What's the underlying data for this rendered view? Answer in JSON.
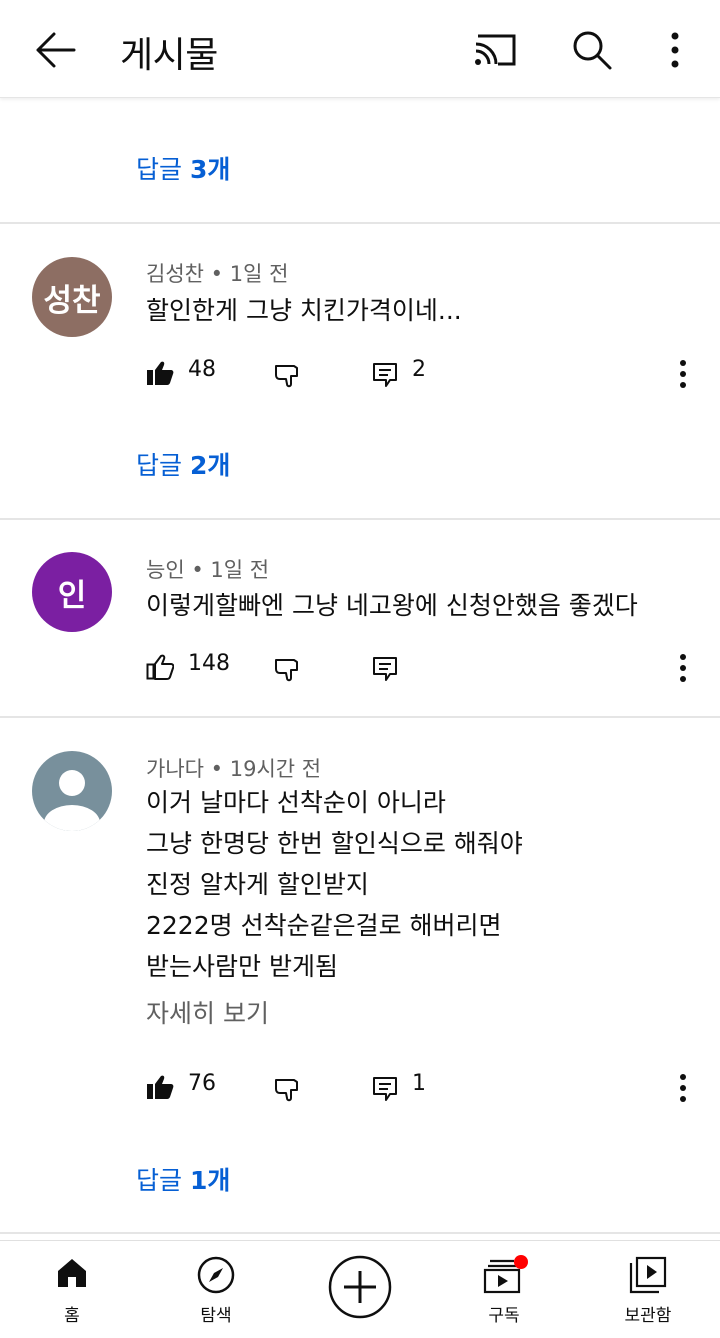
{
  "header": {
    "title": "게시물",
    "icons": [
      "back-arrow-icon",
      "cast-icon",
      "search-icon",
      "more-vert-icon"
    ]
  },
  "top_replies": {
    "prefix": "답글",
    "count_label": "3개"
  },
  "comments": [
    {
      "avatar_text": "성찬",
      "avatar_color": "#8d6e63",
      "author": "김성찬",
      "time": "1일 전",
      "lines": [
        "할인한게 그냥 치킨가격이네..."
      ],
      "likes": "48",
      "liked": true,
      "reply_count": "2",
      "replies": {
        "prefix": "답글",
        "count_label": "2개"
      }
    },
    {
      "avatar_text": "인",
      "avatar_color": "#7b1fa2",
      "author": "능인",
      "time": "1일 전",
      "lines": [
        "이렇게할빠엔 그냥 네고왕에 신청안했음 좋겠다"
      ],
      "likes": "148",
      "liked": false,
      "reply_count": ""
    },
    {
      "avatar_text": "",
      "avatar_color": "#78909c",
      "author": "가나다",
      "time": "19시간 전",
      "lines": [
        "이거 날마다 선착순이 아니라",
        "그냥 한명당 한번 할인식으로 해줘야",
        "진정 알차게 할인받지",
        "2222명 선착순같은걸로 해버리면",
        "받는사람만 받게됨"
      ],
      "read_more": "자세히 보기",
      "likes": "76",
      "liked": true,
      "reply_count": "1",
      "replies": {
        "prefix": "답글",
        "count_label": "1개"
      }
    }
  ],
  "bottom_nav": [
    {
      "label": "홈",
      "icon": "home-icon"
    },
    {
      "label": "탐색",
      "icon": "explore-icon"
    },
    {
      "label": "",
      "icon": "create-icon"
    },
    {
      "label": "구독",
      "icon": "subscriptions-icon"
    },
    {
      "label": "보관함",
      "icon": "library-icon"
    }
  ],
  "colors": {
    "link": "#065fd4",
    "notification_dot": "#ff0000"
  }
}
